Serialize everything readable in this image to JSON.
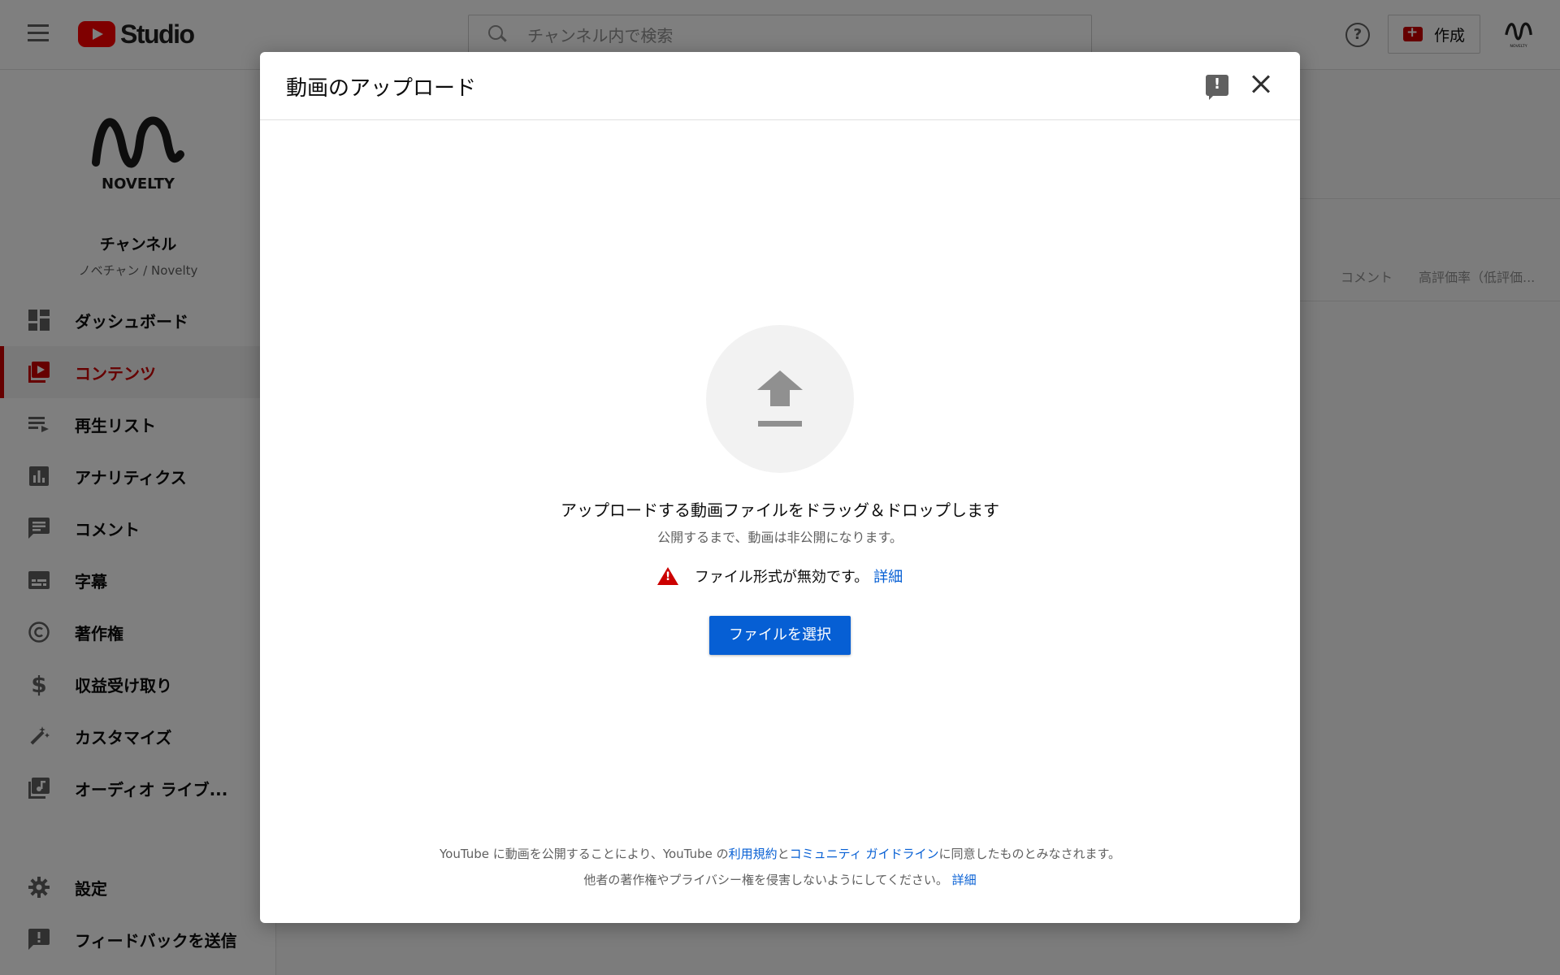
{
  "header": {
    "brand": "Studio",
    "search_placeholder": "チャンネル内で検索",
    "create_label": "作成"
  },
  "channel": {
    "title": "チャンネル",
    "subtitle": "ノベチャン / Novelty",
    "logo_text": "NOVELTY"
  },
  "sidebar": {
    "items": [
      {
        "label": "ダッシュボード",
        "icon": "dashboard-icon"
      },
      {
        "label": "コンテンツ",
        "icon": "content-icon",
        "active": true
      },
      {
        "label": "再生リスト",
        "icon": "playlist-icon"
      },
      {
        "label": "アナリティクス",
        "icon": "analytics-icon"
      },
      {
        "label": "コメント",
        "icon": "comment-icon"
      },
      {
        "label": "字幕",
        "icon": "subtitles-icon"
      },
      {
        "label": "著作権",
        "icon": "copyright-icon"
      },
      {
        "label": "収益受け取り",
        "icon": "dollar-icon"
      },
      {
        "label": "カスタマイズ",
        "icon": "magic-wand-icon"
      },
      {
        "label": "オーディオ ライブ...",
        "icon": "audio-library-icon"
      }
    ],
    "bottom": [
      {
        "label": "設定",
        "icon": "gear-icon"
      },
      {
        "label": "フィードバックを送信",
        "icon": "feedback-icon"
      }
    ]
  },
  "background": {
    "col_comments": "コメント",
    "col_rating": "高評価率（低評価..."
  },
  "dialog": {
    "title": "動画のアップロード",
    "drop_text": "アップロードする動画ファイルをドラッグ＆ドロップします",
    "drop_sub": "公開するまで、動画は非公開になります。",
    "error_text": "ファイル形式が無効です。",
    "error_link": "詳細",
    "select_button": "ファイルを選択",
    "footer_line1_a": "YouTube に動画を公開することにより、YouTube の",
    "footer_terms": "利用規約",
    "footer_and": "と",
    "footer_guidelines": "コミュニティ ガイドライン",
    "footer_line1_b": "に同意したものとみなされます。",
    "footer_line2": "他者の著作権やプライバシー権を侵害しないようにしてください。",
    "footer_link2": "詳細"
  }
}
